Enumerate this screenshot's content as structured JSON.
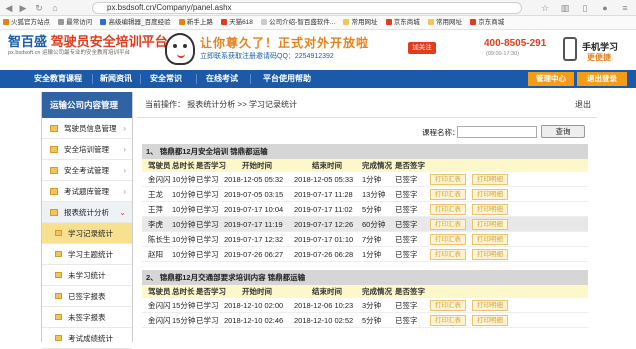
{
  "browser": {
    "url": "px.bsdsoft.cn/Company/panel.ashx",
    "bookmarks": [
      "火狐官方站点",
      "最常访问",
      "高级编辑器_百度经验",
      "新手上路",
      "天猫618",
      "公司介绍-智百盛软件...",
      "常用网址",
      "京东商城",
      "常用网址",
      "京东商城"
    ]
  },
  "header": {
    "logo_main": "智百盛",
    "logo_sub": "px.bsdsoft.cn",
    "logo_title": "驾驶员安全培训平台",
    "logo_desc": "运输公司最专业的安全教育培训平台",
    "slogan": "让你尊久了！正式对外开放啦",
    "slogan2": "立即联系获取注册邀请码QQ：2254912392",
    "follow": "加关注",
    "phone": "400-8505-291",
    "phone_hours": "(09:00-17:30)",
    "mobile": "手机学习",
    "mobile_sub": "更便捷"
  },
  "nav": {
    "items": [
      "安全教育课程",
      "新闻资讯",
      "安全常识",
      "在线考试",
      "平台使用帮助"
    ],
    "user_center": "管理中心",
    "logout": "退出登录"
  },
  "sidebar": {
    "title": "运输公司内容管理",
    "items": [
      {
        "label": "驾驶员信息管理",
        "arrow": "›"
      },
      {
        "label": "安全培训管理",
        "arrow": "›"
      },
      {
        "label": "安全考试管理",
        "arrow": "›"
      },
      {
        "label": "考试题库管理",
        "arrow": "›"
      },
      {
        "label": "报表统计分析",
        "arrow": "⌄"
      }
    ],
    "subitems": [
      "学习记录统计",
      "学习主题统计",
      "未学习统计",
      "已签字报表",
      "未签字报表",
      "考试成绩统计"
    ]
  },
  "main": {
    "breadcrumb_prefix": "当前操作：",
    "breadcrumb1": "报表统计分析",
    "breadcrumb_sep": ">>",
    "breadcrumb2": "学习记录统计",
    "return_label": "退出",
    "search_label": "课程名称：",
    "search_value": "",
    "search_button": "查询",
    "columns": [
      "驾驶员",
      "总时长",
      "是否学习",
      "开始时间",
      "结束时间",
      "完成情况",
      "是否签字"
    ],
    "print_label": "打印汇表",
    "print_detail": "打印明细",
    "sections": [
      {
        "title": "1、  锦鼎都12月安全培训  锦鼎都运输",
        "rows": [
          [
            "金闪闪",
            "10分钟",
            "已学习",
            "2018-12-05 05:32",
            "2018-12-05 05:33",
            "1分钟",
            "已签字"
          ],
          [
            "王龙",
            "10分钟",
            "已学习",
            "2019-07-05 03:15",
            "2019-07-17 11:28",
            "13分钟",
            "已签字"
          ],
          [
            "王萍",
            "10分钟",
            "已学习",
            "2019-07-17 10:04",
            "2019-07-17 11:02",
            "5分钟",
            "已签字"
          ],
          [
            "李虎",
            "10分钟",
            "已学习",
            "2019-07-17 11:19",
            "2019-07-17 12:26",
            "60分钟",
            "已签字"
          ],
          [
            "陈长生",
            "10分钟",
            "已学习",
            "2019-07-17 12:32",
            "2019-07-17 01:10",
            "7分钟",
            "已签字"
          ],
          [
            "赵阳",
            "10分钟",
            "已学习",
            "2019-07-26 06:27",
            "2019-07-26 06:28",
            "1分钟",
            "已签字"
          ]
        ]
      },
      {
        "title": "2、  锦鼎都12月交通部要求培训内容  锦鼎都运输",
        "rows": [
          [
            "金闪闪",
            "15分钟",
            "已学习",
            "2018-12-10 02:00",
            "2018-12-06 10:23",
            "3分钟",
            "已签字"
          ],
          [
            "金闪闪",
            "15分钟",
            "已学习",
            "2018-12-10 02:46",
            "2018-12-10 02:52",
            "5分钟",
            "已签字"
          ]
        ]
      }
    ]
  }
}
